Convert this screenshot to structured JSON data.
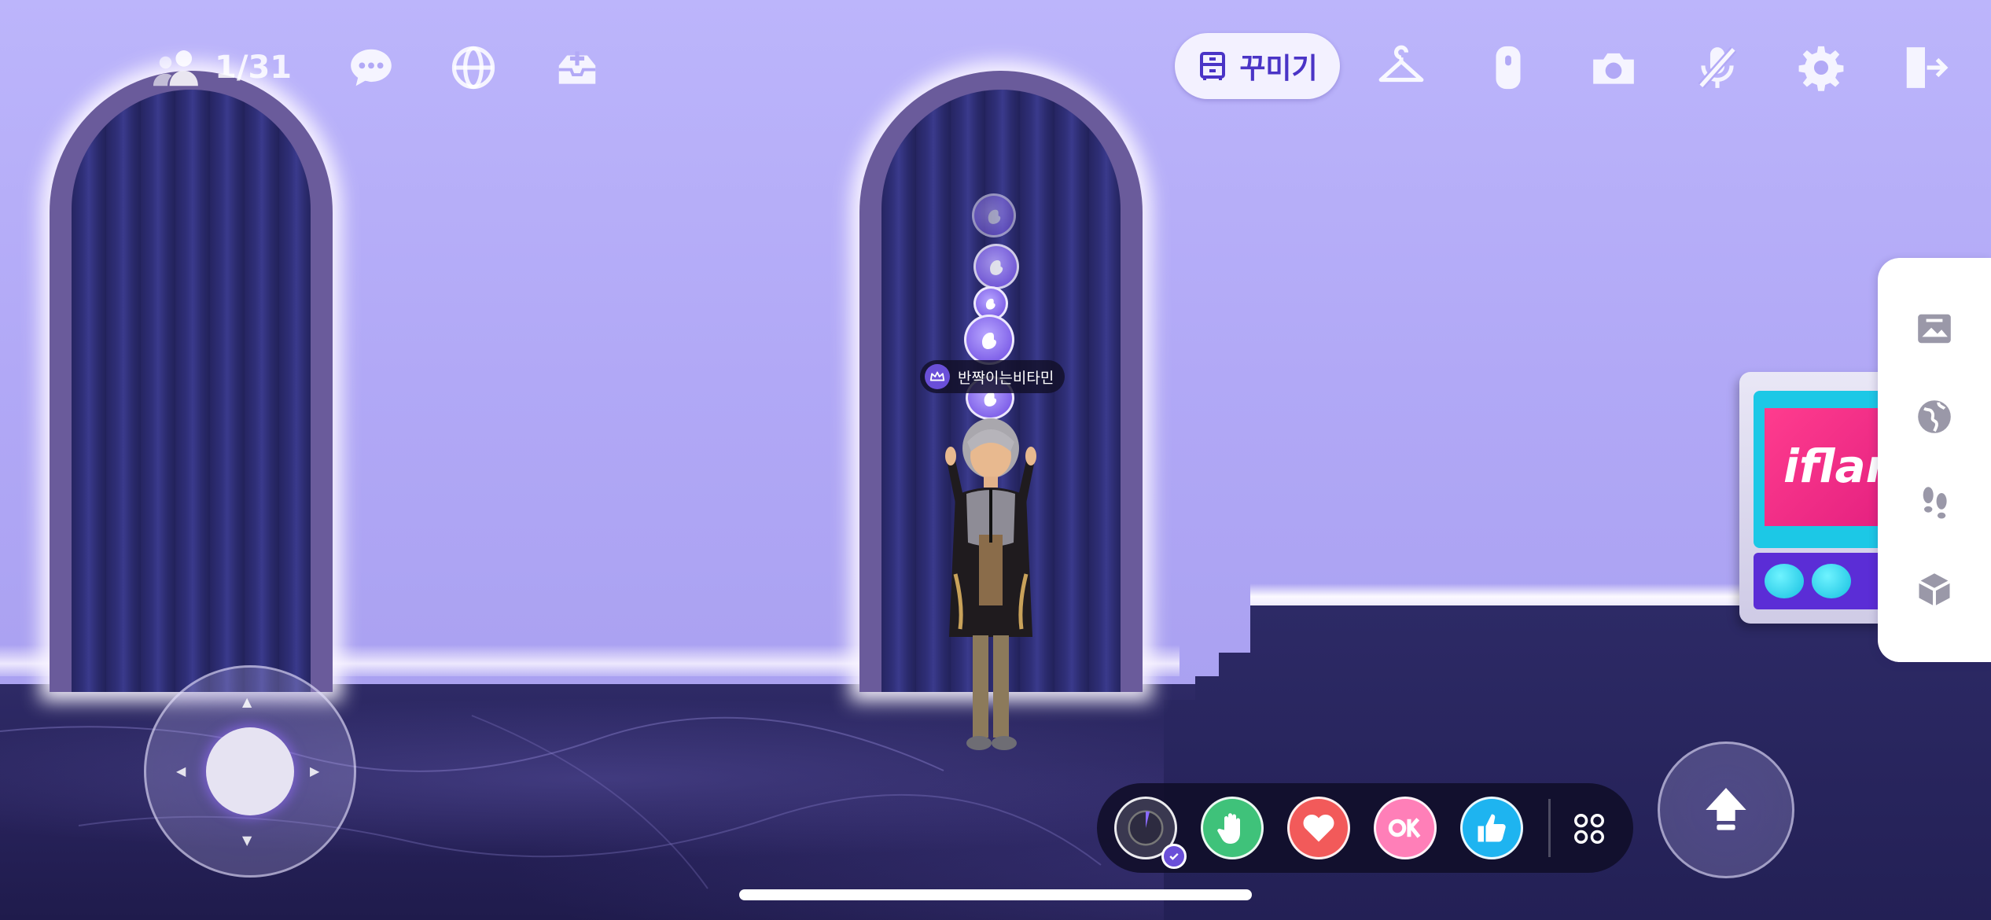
{
  "hud": {
    "player_count": "1/31",
    "decorate_label": "꾸미기"
  },
  "icons": {
    "players": "people-icon",
    "chat": "chat-bubble-icon",
    "globe": "globe-icon",
    "invite": "invite-tray-icon",
    "decorate": "dresser-icon",
    "wardrobe": "hanger-icon",
    "remote": "remote-icon",
    "camera": "camera-icon",
    "mic_off": "mic-off-icon",
    "settings": "gear-icon",
    "exit": "exit-door-icon",
    "side_panel": [
      "image-frame-icon",
      "globe-icon",
      "footprints-icon",
      "cube-icon"
    ],
    "emotes": [
      "dial-icon",
      "raise-hand-icon",
      "heart-icon",
      "ok-icon",
      "thumbs-up-icon",
      "more-grid-icon"
    ],
    "jump": "jump-arrow-icon"
  },
  "avatar": {
    "nickname": "반짝이는비타민"
  },
  "machine": {
    "logo": "iflan"
  },
  "colors": {
    "wall": "#b5adf7",
    "accent": "#4a34c6",
    "emote_raise_hand": "#3fc27a",
    "emote_heart": "#f25a5a",
    "emote_ok": "#ff7fb8",
    "emote_thumbs": "#1eb4f0"
  }
}
